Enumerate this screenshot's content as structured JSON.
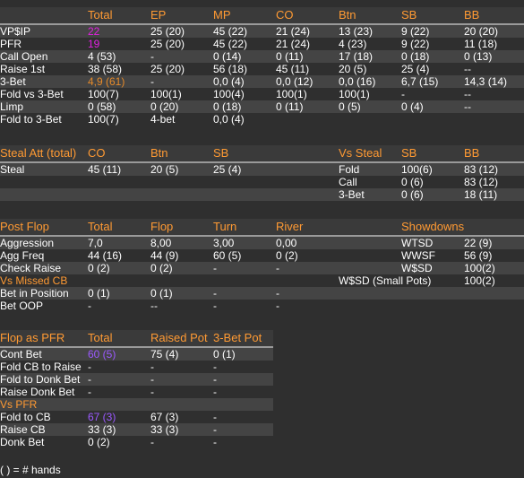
{
  "preflop": {
    "headers": [
      "",
      "Total",
      "EP",
      "MP",
      "CO",
      "Btn",
      "SB",
      "BB"
    ],
    "rows": [
      [
        "VP$IP",
        "22",
        "25 (20)",
        "45 (22)",
        "21 (24)",
        "13 (23)",
        "9 (22)",
        "20 (20)"
      ],
      [
        "PFR",
        "19",
        "25 (20)",
        "45 (22)",
        "21 (24)",
        "4 (23)",
        "9 (22)",
        "11 (18)"
      ],
      [
        "Call Open",
        "4 (53)",
        "-",
        "0 (14)",
        "0 (11)",
        "17 (18)",
        "0 (18)",
        "0 (13)"
      ],
      [
        "Raise 1st",
        "38 (58)",
        "25 (20)",
        "56 (18)",
        "45 (11)",
        "20 (5)",
        "25 (4)",
        "--"
      ],
      [
        "3-Bet",
        "4,9 (61)",
        "-",
        "0,0 (4)",
        "0,0 (12)",
        "0,0 (16)",
        "6,7 (15)",
        "14,3 (14)"
      ],
      [
        "Fold vs 3-Bet",
        "100(7)",
        "100(1)",
        "100(4)",
        "100(1)",
        "100(1)",
        "-",
        "--"
      ],
      [
        "Limp",
        "0 (58)",
        "0 (20)",
        "0 (18)",
        "0 (11)",
        "0 (5)",
        "0 (4)",
        "--"
      ],
      [
        "Fold to 3-Bet",
        "100(7)",
        "4-bet",
        "0,0 (4)",
        "",
        "",
        "",
        ""
      ]
    ]
  },
  "steal": {
    "headers": [
      "Steal Att (total)",
      "CO",
      "Btn",
      "SB",
      "Vs Steal",
      "SB",
      "BB"
    ],
    "rows": [
      [
        "Steal",
        "45 (11)",
        "20 (5)",
        "25 (4)",
        "Fold",
        "100(6)",
        "83 (12)"
      ],
      [
        "",
        "",
        "",
        "",
        "Call",
        "0 (6)",
        "83 (12)"
      ],
      [
        "",
        "",
        "",
        "",
        "3-Bet",
        "0 (6)",
        "18 (11)"
      ]
    ]
  },
  "postflop": {
    "headers": [
      "Post Flop",
      "Total",
      "Flop",
      "Turn",
      "River",
      "Showdowns"
    ],
    "rows": [
      [
        "Aggression",
        "7,0",
        "8,00",
        "3,00",
        "0,00",
        "WTSD",
        "22 (9)"
      ],
      [
        "Agg Freq",
        "44 (16)",
        "44 (9)",
        "60 (5)",
        "0 (2)",
        "WWSF",
        "56 (9)"
      ],
      [
        "Check Raise",
        "0 (2)",
        "0 (2)",
        "-",
        "-",
        "W$SD",
        "100(2)"
      ],
      [
        "Vs Missed CB",
        "",
        "",
        "",
        "",
        "W$SD (Small Pots)",
        "100(2)"
      ],
      [
        "Bet in Position",
        "0 (1)",
        "0 (1)",
        "-",
        "-",
        "",
        ""
      ],
      [
        "Bet OOP",
        "-",
        "--",
        "-",
        "-",
        "",
        ""
      ]
    ]
  },
  "flop_pfr": {
    "headers": [
      "Flop as PFR",
      "Total",
      "Raised Pot",
      "3-Bet Pot"
    ],
    "rows": [
      [
        "Cont Bet",
        "60 (5)",
        "75 (4)",
        "0 (1)"
      ],
      [
        "Fold CB to Raise",
        "-",
        "-",
        "-"
      ],
      [
        "Fold to Donk Bet",
        "-",
        "-",
        "-"
      ],
      [
        "Raise Donk Bet",
        "-",
        "-",
        "-"
      ],
      [
        "Vs PFR",
        "",
        "",
        ""
      ],
      [
        "Fold to CB",
        "67 (3)",
        "67 (3)",
        "-"
      ],
      [
        "Raise CB",
        "33 (3)",
        "33 (3)",
        "-"
      ],
      [
        "Donk Bet",
        "0 (2)",
        "-",
        "-"
      ]
    ]
  },
  "footer": "( ) = # hands"
}
